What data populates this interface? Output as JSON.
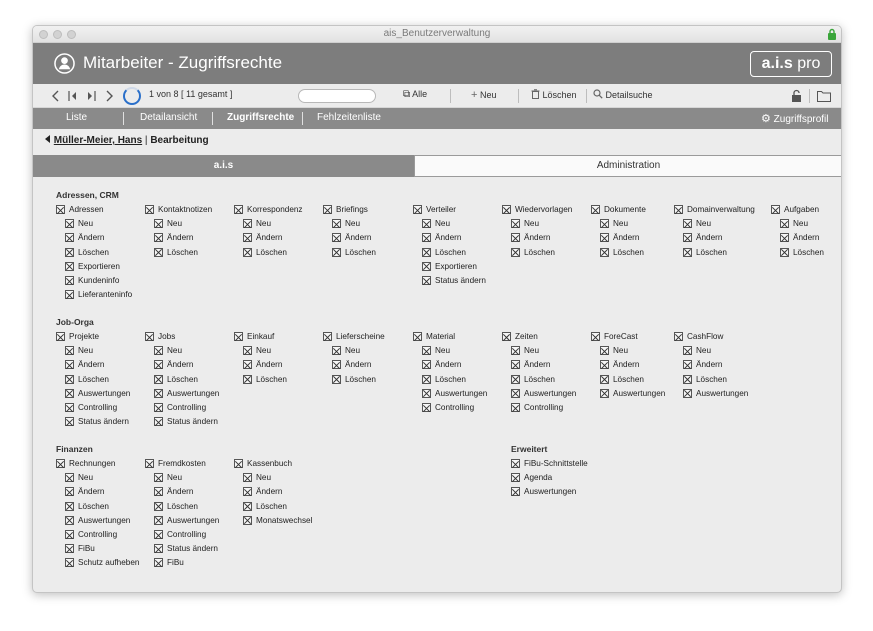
{
  "window": {
    "title": "ais_Benutzerverwaltung"
  },
  "header": {
    "title": "Mitarbeiter - Zugriffsrechte",
    "logo_main": "a.i.s",
    "logo_sub": "pro"
  },
  "toolbar": {
    "record_info": "1 von 8",
    "total_info": "[ 11 gesamt ]",
    "search_placeholder": "",
    "alle_label": "Alle",
    "neu_label": "Neu",
    "loeschen_label": "Löschen",
    "detailsuche_label": "Detailsuche"
  },
  "tabs": [
    {
      "label": "Liste"
    },
    {
      "label": "Detailansicht"
    },
    {
      "label": "Zugriffsrechte"
    },
    {
      "label": "Fehlzeitenliste"
    }
  ],
  "profile_label": "Zugriffsprofil",
  "breadcrumb": {
    "link": "Müller-Meier, Hans",
    "sep": "|",
    "current": "Bearbeitung"
  },
  "segments": {
    "left": "a.i.s",
    "right": "Administration"
  },
  "sections": [
    {
      "title": "Adressen, CRM",
      "groups": [
        {
          "label": "Adressen",
          "items": [
            "Neu",
            "Ändern",
            "Löschen",
            "Exportieren",
            "Kundeninfo",
            "Lieferanteninfo"
          ]
        },
        {
          "label": "Kontaktnotizen",
          "items": [
            "Neu",
            "Ändern",
            "Löschen"
          ]
        },
        {
          "label": "Korrespondenz",
          "items": [
            "Neu",
            "Ändern",
            "Löschen"
          ]
        },
        {
          "label": "Briefings",
          "items": [
            "Neu",
            "Ändern",
            "Löschen"
          ]
        },
        {
          "label": "Verteiler",
          "items": [
            "Neu",
            "Ändern",
            "Löschen",
            "Exportieren",
            "Status ändern"
          ]
        },
        {
          "label": "Wiedervorlagen",
          "items": [
            "Neu",
            "Ändern",
            "Löschen"
          ]
        },
        {
          "label": "Dokumente",
          "items": [
            "Neu",
            "Ändern",
            "Löschen"
          ]
        },
        {
          "label": "Domainverwaltung",
          "items": [
            "Neu",
            "Ändern",
            "Löschen"
          ]
        },
        {
          "label": "Aufgaben",
          "items": [
            "Neu",
            "Ändern",
            "Löschen"
          ]
        }
      ]
    },
    {
      "title": "Job-Orga",
      "groups": [
        {
          "label": "Projekte",
          "items": [
            "Neu",
            "Ändern",
            "Löschen",
            "Auswertungen",
            "Controlling",
            "Status ändern"
          ]
        },
        {
          "label": "Jobs",
          "items": [
            "Neu",
            "Ändern",
            "Löschen",
            "Auswertungen",
            "Controlling",
            "Status ändern"
          ]
        },
        {
          "label": "Einkauf",
          "items": [
            "Neu",
            "Ändern",
            "Löschen"
          ]
        },
        {
          "label": "Lieferscheine",
          "items": [
            "Neu",
            "Ändern",
            "Löschen"
          ]
        },
        {
          "label": "Material",
          "items": [
            "Neu",
            "Ändern",
            "Löschen",
            "Auswertungen",
            "Controlling"
          ]
        },
        {
          "label": "Zeiten",
          "items": [
            "Neu",
            "Ändern",
            "Löschen",
            "Auswertungen",
            "Controlling"
          ]
        },
        {
          "label": "ForeCast",
          "items": [
            "Neu",
            "Ändern",
            "Löschen",
            "Auswertungen"
          ]
        },
        {
          "label": "CashFlow",
          "items": [
            "Neu",
            "Ändern",
            "Löschen",
            "Auswertungen"
          ]
        }
      ]
    },
    {
      "title": "Finanzen",
      "groups": [
        {
          "label": "Rechnungen",
          "items": [
            "Neu",
            "Ändern",
            "Löschen",
            "Auswertungen",
            "Controlling",
            "FiBu",
            "Schutz aufheben"
          ]
        },
        {
          "label": "Fremdkosten",
          "items": [
            "Neu",
            "Ändern",
            "Löschen",
            "Auswertungen",
            "Controlling",
            "Status ändern",
            "FiBu"
          ]
        },
        {
          "label": "Kassenbuch",
          "items": [
            "Neu",
            "Ändern",
            "Löschen",
            "Monatswechsel"
          ]
        }
      ]
    },
    {
      "title": "Erweitert",
      "groups": [
        {
          "label": "FiBu-Schnittstelle",
          "items": []
        },
        {
          "label": "Agenda",
          "items": []
        },
        {
          "label": "Auswertungen",
          "items": []
        }
      ]
    }
  ]
}
